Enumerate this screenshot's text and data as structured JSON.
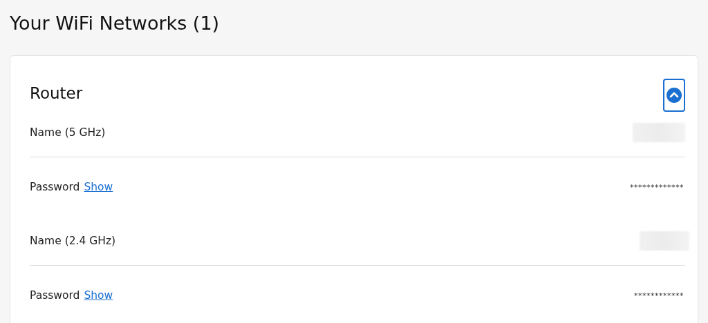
{
  "heading": "Your WiFi Networks (1)",
  "card": {
    "title": "Router",
    "expanded": true,
    "rows": [
      {
        "kind": "name",
        "label": "Name (5 GHz)"
      },
      {
        "kind": "password",
        "label": "Password",
        "link": "Show",
        "value": "*************"
      },
      {
        "kind": "name",
        "label": "Name (2.4 GHz)"
      },
      {
        "kind": "password",
        "label": "Password",
        "link": "Show",
        "value": "************"
      }
    ]
  }
}
